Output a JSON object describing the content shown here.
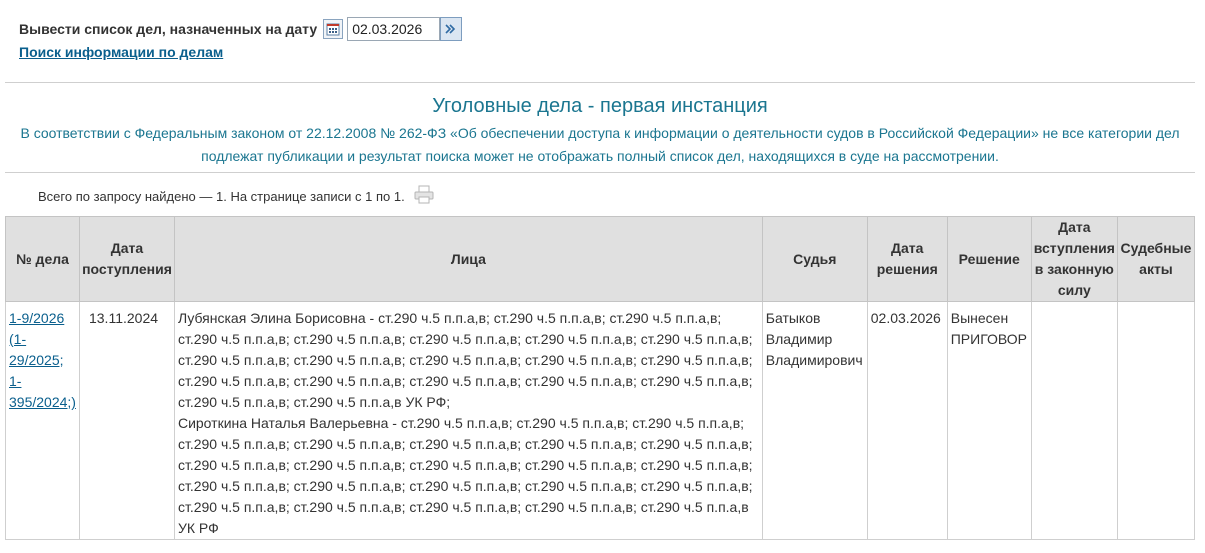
{
  "filter": {
    "date_label": "Вывести список дел, назначенных на дату",
    "date_value": "02.03.2026",
    "search_link": "Поиск информации по делам"
  },
  "heading": {
    "title": "Уголовные дела - первая инстанция",
    "notice": "В соответствии с Федеральным законом от 22.12.2008 № 262-ФЗ «Об обеспечении доступа к информации о деятельности судов в Российской Федерации» не все категории дел подлежат публикации и результат поиска может не отображать полный список дел, находящихся в суде на рассмотрении."
  },
  "results": {
    "summary": "Всего по запросу найдено — 1. На странице записи с 1 по 1."
  },
  "icons": {
    "calendar": "calendar-icon",
    "go": "arrow-right-icon",
    "print": "printer-icon"
  },
  "colors": {
    "link": "#0a5f8d",
    "title": "#1b7690",
    "header_bg": "#e0e0e0"
  },
  "table": {
    "headers": {
      "case_number": "№ дела",
      "received_date": "Дата поступления",
      "persons": "Лица",
      "judge": "Судья",
      "decision_date": "Дата решения",
      "decision": "Решение",
      "effective_date": "Дата вступления в законную силу",
      "judicial_acts": "Судебные акты"
    },
    "rows": [
      {
        "case_number": "1-9/2026 (1-29/2025; 1-395/2024;)",
        "received_date": "13.11.2024",
        "persons": [
          "Лубянская Элина Борисовна - ст.290 ч.5 п.п.а,в; ст.290 ч.5 п.п.а,в; ст.290 ч.5 п.п.а,в; ст.290 ч.5 п.п.а,в; ст.290 ч.5 п.п.а,в; ст.290 ч.5 п.п.а,в; ст.290 ч.5 п.п.а,в; ст.290 ч.5 п.п.а,в; ст.290 ч.5 п.п.а,в; ст.290 ч.5 п.п.а,в; ст.290 ч.5 п.п.а,в; ст.290 ч.5 п.п.а,в; ст.290 ч.5 п.п.а,в; ст.290 ч.5 п.п.а,в; ст.290 ч.5 п.п.а,в; ст.290 ч.5 п.п.а,в; ст.290 ч.5 п.п.а,в; ст.290 ч.5 п.п.а,в; ст.290 ч.5 п.п.а,в; ст.290 ч.5 п.п.а,в УК РФ;",
          "Сироткина Наталья Валерьевна - ст.290 ч.5 п.п.а,в; ст.290 ч.5 п.п.а,в; ст.290 ч.5 п.п.а,в; ст.290 ч.5 п.п.а,в; ст.290 ч.5 п.п.а,в; ст.290 ч.5 п.п.а,в; ст.290 ч.5 п.п.а,в; ст.290 ч.5 п.п.а,в; ст.290 ч.5 п.п.а,в; ст.290 ч.5 п.п.а,в; ст.290 ч.5 п.п.а,в; ст.290 ч.5 п.п.а,в; ст.290 ч.5 п.п.а,в; ст.290 ч.5 п.п.а,в; ст.290 ч.5 п.п.а,в; ст.290 ч.5 п.п.а,в; ст.290 ч.5 п.п.а,в; ст.290 ч.5 п.п.а,в; ст.290 ч.5 п.п.а,в; ст.290 ч.5 п.п.а,в; ст.290 ч.5 п.п.а,в; ст.290 ч.5 п.п.а,в; ст.290 ч.5 п.п.а,в УК РФ"
        ],
        "judge": "Батыков Владимир Владимирович",
        "decision_date": "02.03.2026",
        "decision": "Вынесен ПРИГОВОР",
        "effective_date": "",
        "judicial_acts": ""
      }
    ]
  }
}
